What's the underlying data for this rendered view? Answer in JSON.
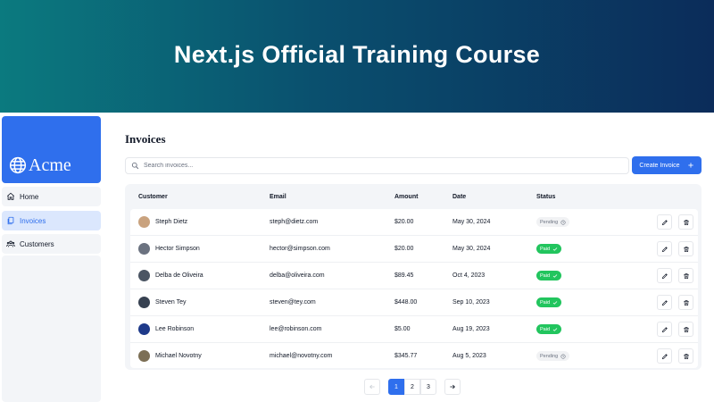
{
  "banner": {
    "title": "Next.js Official Training Course"
  },
  "sidebar": {
    "logo_text": "Acme",
    "items": [
      {
        "label": "Home",
        "icon": "home-icon",
        "active": false
      },
      {
        "label": "Invoices",
        "icon": "document-icon",
        "active": true
      },
      {
        "label": "Customers",
        "icon": "users-icon",
        "active": false
      }
    ]
  },
  "main": {
    "title": "Invoices",
    "search_placeholder": "Search invoices...",
    "create_label": "Create Invoice",
    "columns": [
      "Customer",
      "Email",
      "Amount",
      "Date",
      "Status"
    ],
    "rows": [
      {
        "customer": "Steph Dietz",
        "email": "steph@dietz.com",
        "amount": "$20.00",
        "date": "May 30, 2024",
        "status": "Pending"
      },
      {
        "customer": "Hector Simpson",
        "email": "hector@simpson.com",
        "amount": "$20.00",
        "date": "May 30, 2024",
        "status": "Paid"
      },
      {
        "customer": "Delba de Oliveira",
        "email": "delba@oliveira.com",
        "amount": "$89.45",
        "date": "Oct 4, 2023",
        "status": "Paid"
      },
      {
        "customer": "Steven Tey",
        "email": "steven@tey.com",
        "amount": "$448.00",
        "date": "Sep 10, 2023",
        "status": "Paid"
      },
      {
        "customer": "Lee Robinson",
        "email": "lee@robinson.com",
        "amount": "$5.00",
        "date": "Aug 19, 2023",
        "status": "Paid"
      },
      {
        "customer": "Michael Novotny",
        "email": "michael@novotny.com",
        "amount": "$345.77",
        "date": "Aug 5, 2023",
        "status": "Pending"
      }
    ]
  },
  "pagination": {
    "pages": [
      "1",
      "2",
      "3"
    ],
    "current": "1"
  },
  "colors": {
    "accent": "#2f6fed",
    "paid": "#22c55e",
    "pending_bg": "#f1f2f4"
  }
}
